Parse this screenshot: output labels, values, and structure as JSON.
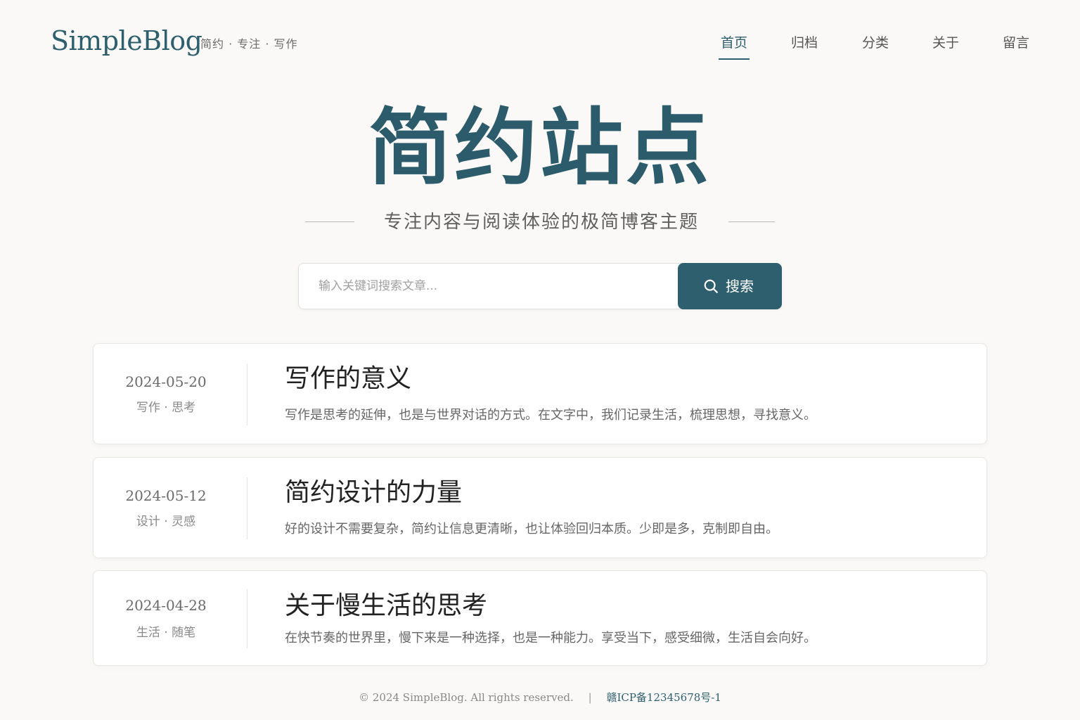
{
  "header": {
    "logo": "SimpleBlog",
    "tagline": "简约 · 专注 · 写作",
    "nav": [
      {
        "label": "首页",
        "active": true
      },
      {
        "label": "归档",
        "active": false
      },
      {
        "label": "分类",
        "active": false
      },
      {
        "label": "关于",
        "active": false
      },
      {
        "label": "留言",
        "active": false
      }
    ]
  },
  "hero": {
    "title": "简约站点",
    "subtitle": "专注内容与阅读体验的极简博客主题"
  },
  "search": {
    "placeholder": "输入关键词搜索文章...",
    "button_label": "搜索",
    "icon": "search-icon"
  },
  "posts": [
    {
      "date": "2024-05-20",
      "tags": "写作 · 思考",
      "title": "写作的意义",
      "excerpt": "写作是思考的延伸，也是与世界对话的方式。在文字中，我们记录生活，梳理思想，寻找意义。"
    },
    {
      "date": "2024-05-12",
      "tags": "设计 · 灵感",
      "title": "简约设计的力量",
      "excerpt": "好的设计不需要复杂，简约让信息更清晰，也让体验回归本质。少即是多，克制即自由。"
    },
    {
      "date": "2024-04-28",
      "tags": "生活 · 随笔",
      "title": "关于慢生活的思考",
      "excerpt": "在快节奏的世界里，慢下来是一种选择，也是一种能力。享受当下，感受细微，生活自会向好。"
    }
  ],
  "footer": {
    "copyright": "© 2024 SimpleBlog. All rights reserved.",
    "separator": "|",
    "icp": "赣ICP备12345678号-1"
  },
  "colors": {
    "accent": "#2e5f6e",
    "background": "#faf9f7",
    "card": "#ffffff"
  }
}
